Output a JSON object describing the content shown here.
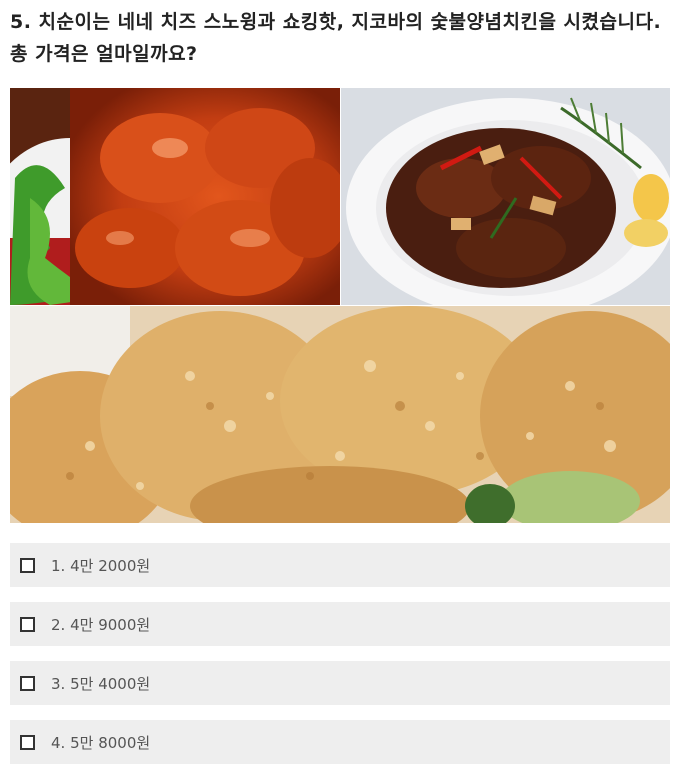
{
  "question": {
    "text": "5. 치순이는 네네 치즈 스노윙과 쇼킹핫, 지코바의 숯불양념치킨을 시켰습니다. 총 가격은 얼마일까요?"
  },
  "images": [
    {
      "name": "spicy-chicken-photo"
    },
    {
      "name": "soy-grilled-chicken-photo"
    },
    {
      "name": "cheese-snowing-chicken-photo"
    }
  ],
  "options": [
    {
      "label": "1. 4만 2000원"
    },
    {
      "label": "2. 4만 9000원"
    },
    {
      "label": "3. 5만 4000원"
    },
    {
      "label": "4. 5만 8000원"
    }
  ],
  "colors": {
    "option_bg": "#eeeeee",
    "text": "#222222"
  }
}
